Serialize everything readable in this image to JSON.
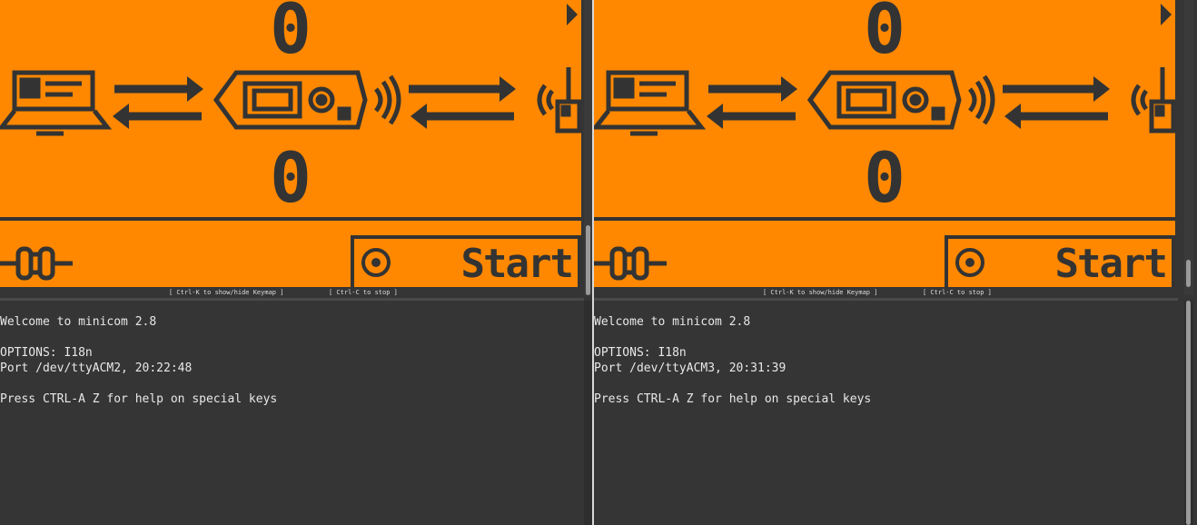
{
  "panes": [
    {
      "lcd": {
        "counter_top": "0",
        "counter_bottom": "0",
        "start_label": "Start"
      },
      "hints": [
        "[ Ctrl-K to show/hide Keymap ]",
        "[ Ctrl-C to stop ]"
      ],
      "terminal": {
        "welcome": "Welcome to minicom 2.8",
        "options": "OPTIONS: I18n",
        "port": "Port /dev/ttyACM2, 20:22:48",
        "help": "Press CTRL-A Z for help on special keys"
      }
    },
    {
      "lcd": {
        "counter_top": "0",
        "counter_bottom": "0",
        "start_label": "Start"
      },
      "hints": [
        "[ Ctrl-K to show/hide Keymap ]",
        "[ Ctrl-C to stop ]"
      ],
      "terminal": {
        "welcome": "Welcome to minicom 2.8",
        "options": "OPTIONS: I18n",
        "port": "Port /dev/ttyACM3, 20:31:39",
        "help": "Press CTRL-A Z for help on special keys"
      }
    }
  ],
  "colors": {
    "lcd_background": "#ff8800",
    "lcd_ink": "#333333",
    "terminal_bg": "#353535",
    "terminal_text": "#e8e8e8"
  },
  "icons": [
    "laptop-icon",
    "bidirectional-arrows-icon",
    "usb-dongle-icon",
    "radio-waves-icon",
    "radio-device-icon",
    "plug-icon",
    "record-icon",
    "play-icon"
  ]
}
